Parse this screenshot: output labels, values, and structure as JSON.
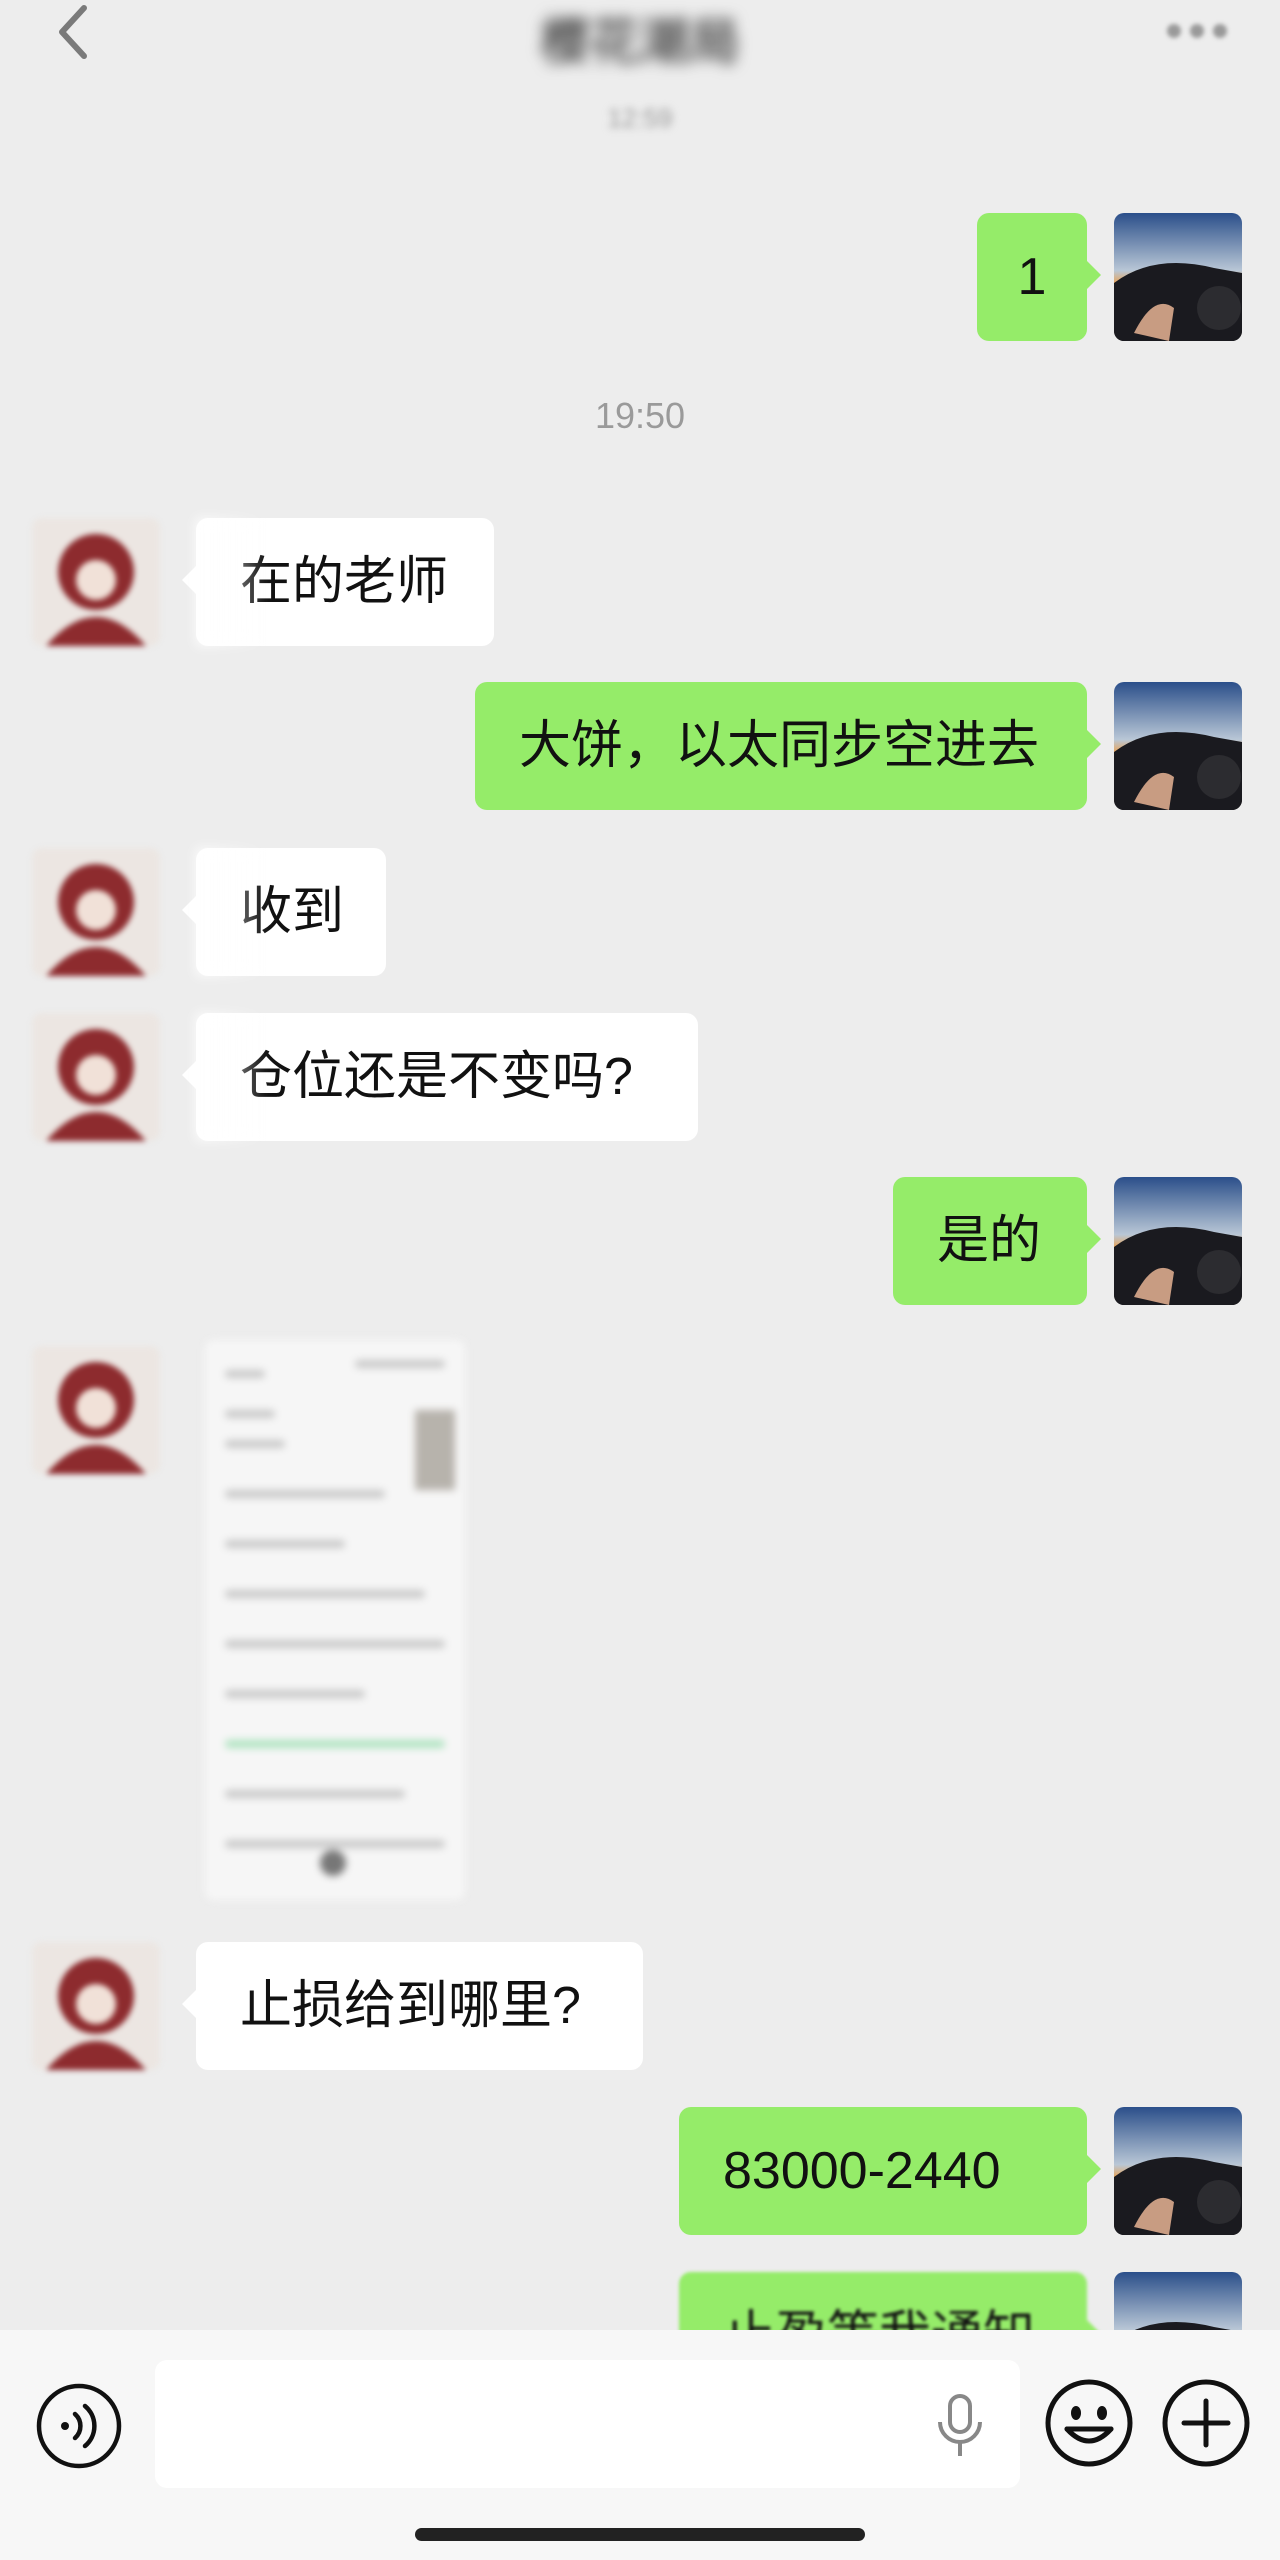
{
  "header": {
    "back_icon": "chevron-left-icon",
    "title": "樱花潮局",
    "more_icon": "ellipsis-icon"
  },
  "timestamps": {
    "first": "12:59",
    "second": "19:50"
  },
  "messages": [
    {
      "from": "me",
      "text": "1"
    },
    {
      "from": "other",
      "text": "在的老师"
    },
    {
      "from": "me",
      "text": "大饼，以太同步空进去"
    },
    {
      "from": "other",
      "text": "收到"
    },
    {
      "from": "other",
      "text": "仓位还是不变吗?"
    },
    {
      "from": "me",
      "text": "是的"
    },
    {
      "from": "other",
      "type": "image"
    },
    {
      "from": "other",
      "text": "止损给到哪里?"
    },
    {
      "from": "me",
      "text": "83000-2440"
    },
    {
      "from": "me",
      "text": "止盈等我通知"
    }
  ],
  "input_bar": {
    "voice_icon": "voice-icon",
    "mic_icon": "microphone-icon",
    "emoji_icon": "emoji-icon",
    "plus_icon": "plus-icon",
    "placeholder": ""
  },
  "colors": {
    "background": "#ededed",
    "my_bubble": "#95ec69",
    "their_bubble": "#ffffff"
  }
}
